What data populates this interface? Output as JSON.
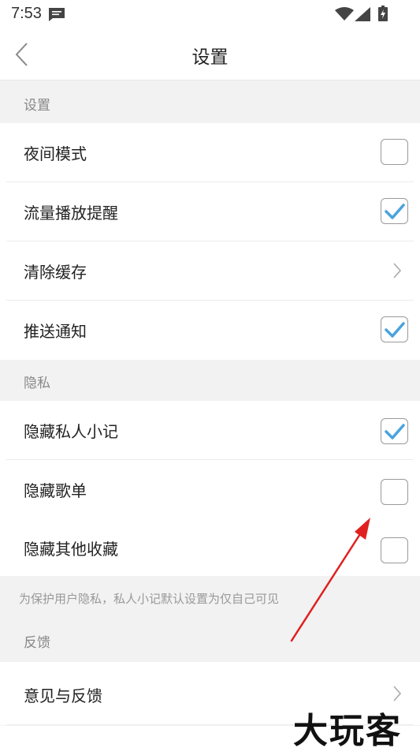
{
  "status_bar": {
    "time": "7:53",
    "icons": [
      "message-icon",
      "wifi-icon",
      "signal-icon",
      "battery-charging-icon"
    ]
  },
  "header": {
    "back_icon": "chevron-left-icon",
    "title": "设置"
  },
  "sections": {
    "settings": {
      "header": "设置",
      "items": [
        {
          "label": "夜间模式",
          "control": "checkbox",
          "checked": false
        },
        {
          "label": "流量播放提醒",
          "control": "checkbox",
          "checked": true
        },
        {
          "label": "清除缓存",
          "control": "chevron"
        },
        {
          "label": "推送通知",
          "control": "checkbox",
          "checked": true
        }
      ]
    },
    "privacy": {
      "header": "隐私",
      "items": [
        {
          "label": "隐藏私人小记",
          "control": "checkbox",
          "checked": true
        },
        {
          "label": "隐藏歌单",
          "control": "checkbox",
          "checked": false
        },
        {
          "label": "隐藏其他收藏",
          "control": "checkbox",
          "checked": false
        }
      ],
      "note": "为保护用户隐私，私人小记默认设置为仅自己可见"
    },
    "feedback": {
      "header": "反馈",
      "items": [
        {
          "label": "意见与反馈",
          "control": "chevron"
        }
      ]
    }
  },
  "colors": {
    "checkmark": "#4aa3dd",
    "annotation_arrow": "#e02020"
  },
  "watermark": "大玩客"
}
